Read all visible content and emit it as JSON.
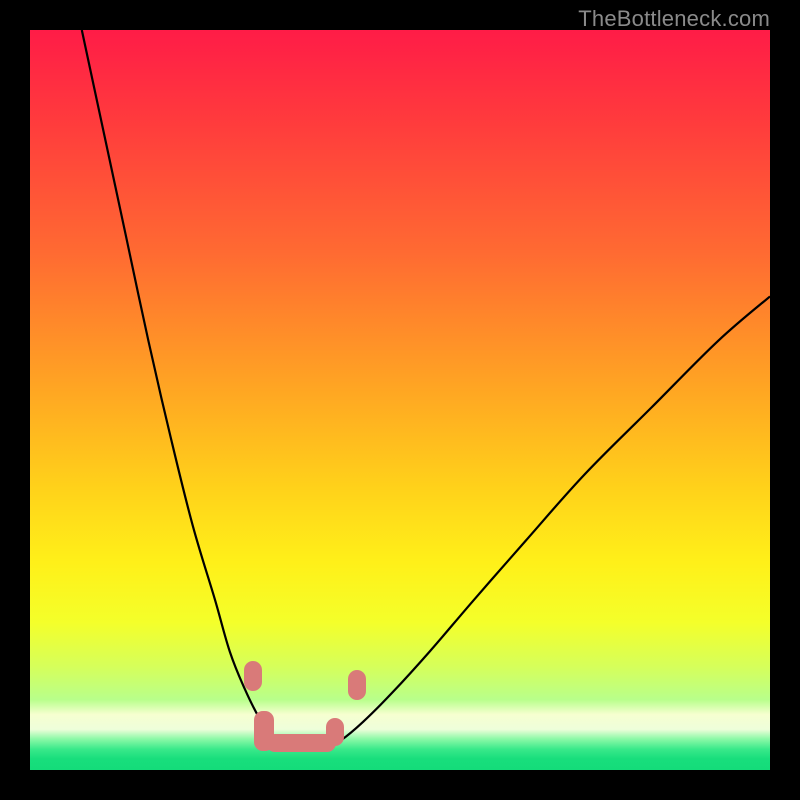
{
  "watermark": "TheBottleneck.com",
  "colors": {
    "black": "#000000",
    "curve": "#000000",
    "blob": "#d97a79",
    "gradient_stops": [
      {
        "offset": 0.0,
        "color": "#ff1c47"
      },
      {
        "offset": 0.12,
        "color": "#ff3a3d"
      },
      {
        "offset": 0.3,
        "color": "#ff6a32"
      },
      {
        "offset": 0.48,
        "color": "#ffa423"
      },
      {
        "offset": 0.62,
        "color": "#ffd21a"
      },
      {
        "offset": 0.72,
        "color": "#fff019"
      },
      {
        "offset": 0.8,
        "color": "#f4ff2a"
      },
      {
        "offset": 0.86,
        "color": "#d6ff5a"
      },
      {
        "offset": 0.905,
        "color": "#b8ff8b"
      },
      {
        "offset": 0.925,
        "color": "#f6ffd0"
      },
      {
        "offset": 0.945,
        "color": "#eefeda"
      },
      {
        "offset": 0.958,
        "color": "#8cf9a7"
      },
      {
        "offset": 0.972,
        "color": "#39e98a"
      },
      {
        "offset": 0.985,
        "color": "#18de7c"
      },
      {
        "offset": 1.0,
        "color": "#14dc7a"
      }
    ]
  },
  "chart_data": {
    "type": "line",
    "title": "",
    "xlabel": "",
    "ylabel": "",
    "xlim": [
      0,
      100
    ],
    "ylim": [
      0,
      100
    ],
    "series": [
      {
        "name": "left-curve",
        "x": [
          7,
          10,
          13,
          16,
          19,
          22,
          25,
          27,
          29,
          31,
          32.5,
          34,
          35
        ],
        "y": [
          100,
          86,
          72,
          58,
          45,
          33,
          23,
          16,
          11,
          7,
          5,
          3.5,
          3
        ]
      },
      {
        "name": "right-curve",
        "x": [
          40,
          42,
          45,
          49,
          54,
          60,
          67,
          75,
          84,
          93,
          100
        ],
        "y": [
          3,
          4,
          6.5,
          10.5,
          16,
          23,
          31,
          40,
          49,
          58,
          64
        ]
      }
    ],
    "markers": [
      {
        "name": "left-upper-pair-a",
        "x": 30.1,
        "y": 13.5
      },
      {
        "name": "left-upper-pair-b",
        "x": 30.6,
        "y": 11.8
      },
      {
        "name": "bottom-bar-start",
        "x": 32.0,
        "y": 4.0
      },
      {
        "name": "bottom-bar-end",
        "x": 40.0,
        "y": 3.0
      },
      {
        "name": "right-lower",
        "x": 42.5,
        "y": 5.8
      },
      {
        "name": "right-upper-pair-a",
        "x": 44.4,
        "y": 10.0
      },
      {
        "name": "right-upper-pair-b",
        "x": 45.2,
        "y": 11.6
      }
    ]
  }
}
